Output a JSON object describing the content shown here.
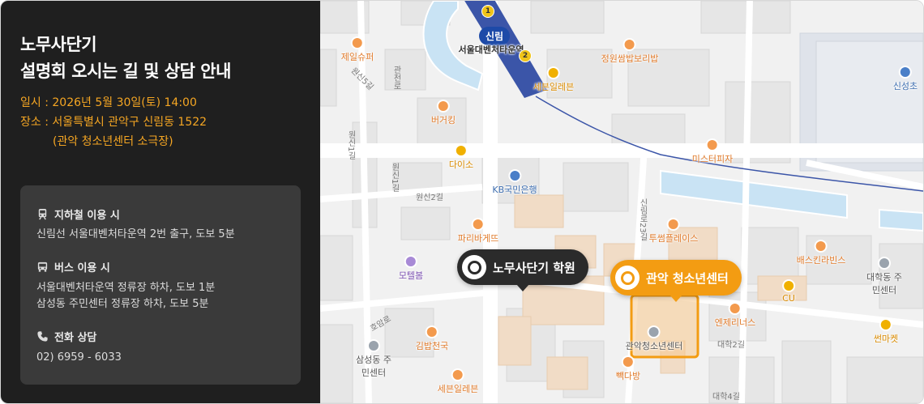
{
  "panel": {
    "title_line1": "노무사단기",
    "title_line2": "설명회 오시는 길 및 상담 안내",
    "date_row": "일시 : 2026년 5월 30일(토) 14:00",
    "place_row": "장소 : 서울특별시 관악구 신림동 1522",
    "place_detail": "(관악 청소년센터 소극장)"
  },
  "info": {
    "subway_title": "지하철 이용 시",
    "subway_text": "신림선 서울대벤처타운역 2번 출구, 도보 5분",
    "bus_title": "버스 이용 시",
    "bus_text_1": "서울대벤처타운역 정류장 하차, 도보 1분",
    "bus_text_2": "삼성동 주민센터 정류장 하차, 도보 5분",
    "phone_title": "전화 상담",
    "phone_text": "02) 6959 - 6033",
    "icons": [
      "subway-icon",
      "bus-icon",
      "phone-icon"
    ]
  },
  "map": {
    "markers": {
      "academy": "노무사단기 학원",
      "youth_center": "관악 청소년센터"
    },
    "station": {
      "line_label": "신림",
      "name": "서울대벤처타운역",
      "badge_1": "1",
      "badge_2": "2"
    },
    "pois": {
      "p1": "제일슈퍼",
      "p2": "버거킹",
      "p3": "다이소",
      "p4": "KB국민은행",
      "p5": "파리바게뜨",
      "p6": "모텔봄",
      "p7": "김밥천국",
      "p8": "세븐일레븐",
      "p9": "삼성동 주민센터",
      "p10": "정원쌈밥보리밥",
      "p11": "세븐일레븐",
      "p12": "미스터피자",
      "p13": "투썸플레이스",
      "p14": "배스킨라빈스",
      "p15": "대학동 주민센터",
      "p16": "CU",
      "p17": "엔제리너스",
      "p18": "썬마켓",
      "p19": "관악청소년센터",
      "p20": "빽다방",
      "p21": "신성초"
    },
    "roads": {
      "r1": "원신5길",
      "r2": "원신1길",
      "r3": "원신2길",
      "r4": "원신1길",
      "r5": "신림로23길",
      "r6": "대학2길",
      "r7": "대학4길",
      "r8": "호암로",
      "r9": "관천로"
    },
    "colors": {
      "stream": "#c9e3f4",
      "subway_line": "#3b55a8",
      "highlight": "#f39c12"
    }
  }
}
